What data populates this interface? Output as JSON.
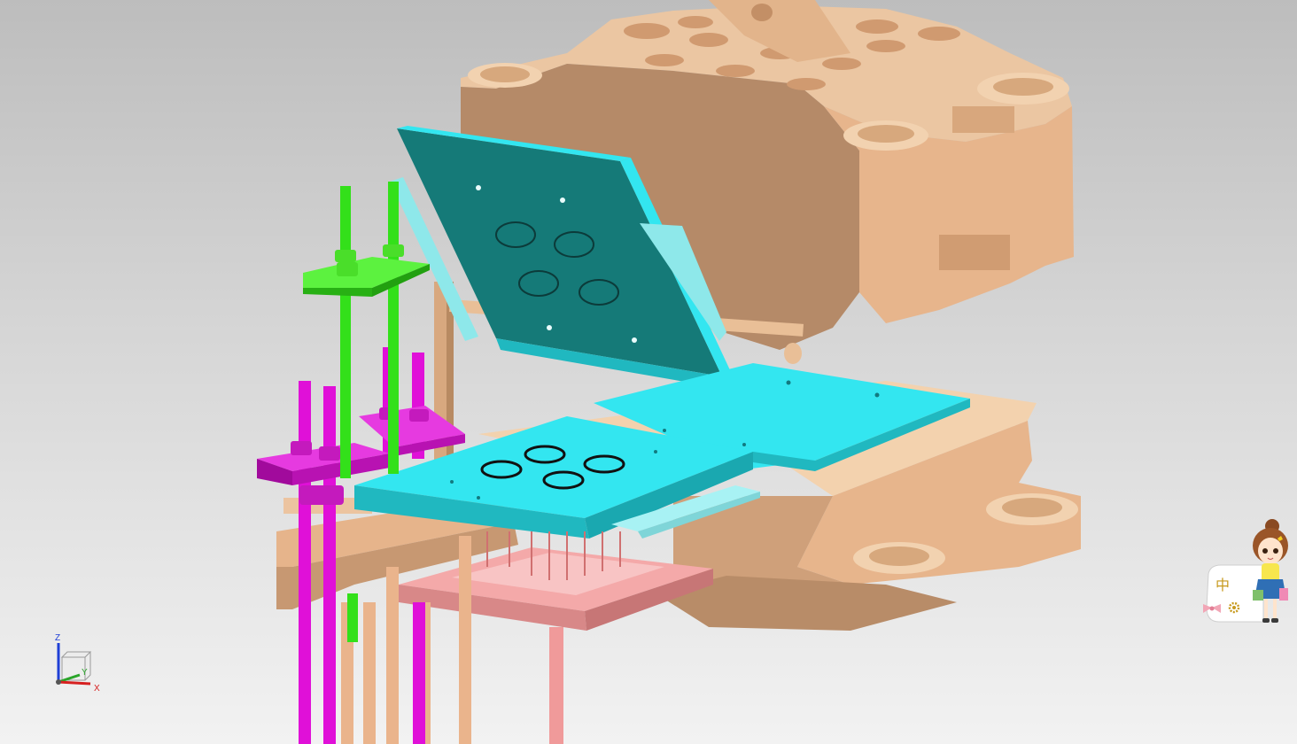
{
  "triad": {
    "z_label": "Z",
    "y_label": "Y",
    "x_label": "X",
    "colors": {
      "z": "#1f3fd6",
      "y": "#2aa52a",
      "x": "#d62020"
    }
  },
  "ime_widget": {
    "mode_char": "中",
    "settings_icon": "gear-icon",
    "mascot_icon": "cartoon-girl-icon"
  },
  "colors": {
    "mold_base": "#e8bf98",
    "mold_shadow": "#c9996f",
    "plate_cyan": "#33e6f0",
    "plate_teal": "#157a78",
    "rods_green": "#33e01a",
    "rods_magenta": "#e010d8",
    "ejector_pink": "#f0a0a0"
  }
}
